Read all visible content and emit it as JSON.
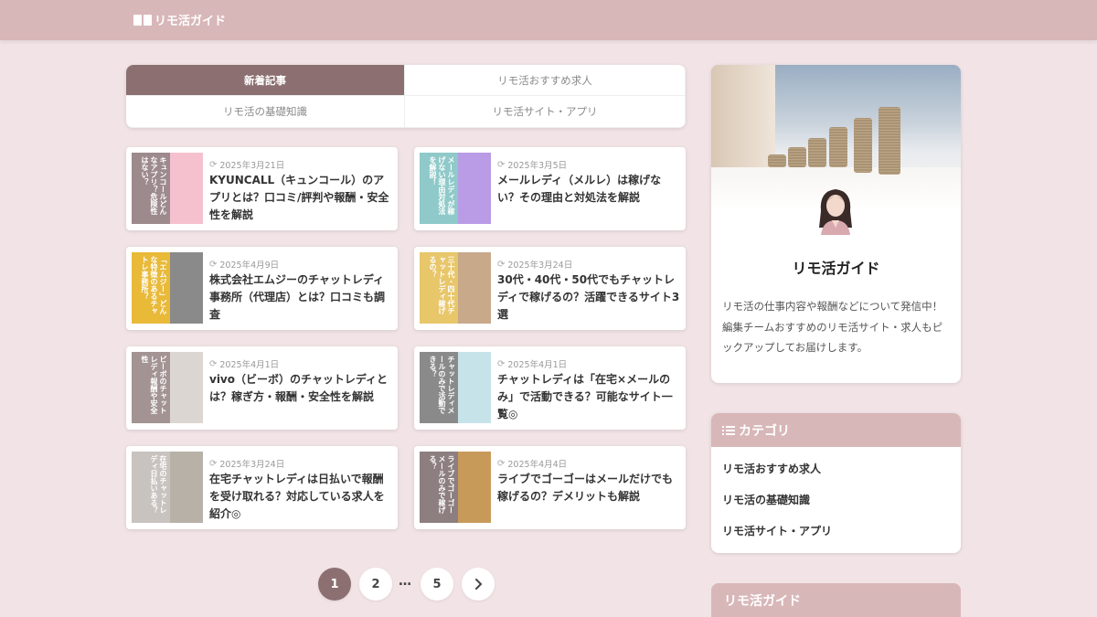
{
  "header": {
    "logo_text": "リモ活ガイド"
  },
  "tabs": [
    {
      "label": "新着記事",
      "active": true
    },
    {
      "label": "リモ活おすすめ求人",
      "active": false
    },
    {
      "label": "リモ活の基礎知識",
      "active": false
    },
    {
      "label": "リモ活サイト・アプリ",
      "active": false
    }
  ],
  "articles": [
    {
      "date": "2025年3月21日",
      "title": "KYUNCALL（キュンコール）のアプリとは？口コミ/評判や報酬・安全性を解説",
      "thumb_text": "キュンコールどんなアプリ？危険性はない？",
      "band_color": "#9d8a8d",
      "rest_color": "#f6c1cf"
    },
    {
      "date": "2025年3月5日",
      "title": "メールレディ（メルレ）は稼げない？その理由と対処法を解説",
      "thumb_text": "メールレディが稼げない理由対処法を解説！",
      "band_color": "#8fc9c9",
      "rest_color": "#b99be6"
    },
    {
      "date": "2025年4月9日",
      "title": "株式会社エムジーのチャットレディ事務所（代理店）とは？口コミも調査",
      "thumb_text": "「エムジー」どんな特徴のあるチャトレ事務所？",
      "band_color": "#e9b938",
      "rest_color": "#8a8a8a"
    },
    {
      "date": "2025年3月24日",
      "title": "30代・40代・50代でもチャットレディで稼げるの？活躍できるサイト3選",
      "thumb_text": "三十代・四十代チャットレディ稼げるの？",
      "band_color": "#e8c66a",
      "rest_color": "#c8a98a"
    },
    {
      "date": "2025年4月1日",
      "title": "vivo（ビーボ）のチャットレディとは？稼ぎ方・報酬・安全性を解説",
      "thumb_text": "ビーボのチャットレディ報酬や安全性",
      "band_color": "#a39393",
      "rest_color": "#dcd6d2"
    },
    {
      "date": "2025年4月1日",
      "title": "チャットレディは「在宅×メールのみ」で活動できる？可能なサイト一覧◎",
      "thumb_text": "チャットレディメールのみで活動できる？",
      "band_color": "#8a8a8a",
      "rest_color": "#c7e3ea"
    },
    {
      "date": "2025年3月24日",
      "title": "在宅チャットレディは日払いで報酬を受け取れる？対応している求人を紹介◎",
      "thumb_text": "在宅のチャットレディ日払いある？",
      "band_color": "#c9c3c0",
      "rest_color": "#b7b1a7"
    },
    {
      "date": "2025年4月4日",
      "title": "ライブでゴーゴーはメールだけでも稼げるの？デメリットも解説",
      "thumb_text": "ライブでゴーゴーメールのみで稼げる？",
      "band_color": "#8d7e7f",
      "rest_color": "#c79a5a"
    }
  ],
  "pagination": {
    "pages": [
      "1",
      "2",
      "5"
    ],
    "current": "1",
    "ellipsis": "…",
    "next_icon": "chevron-right-icon"
  },
  "profile": {
    "name": "リモ活ガイド",
    "description": "リモ活の仕事内容や報酬などについて発信中！編集チームおすすめのリモ活サイト・求人もピックアップしてお届けします。"
  },
  "category": {
    "heading": "カテゴリ",
    "items": [
      "リモ活おすすめ求人",
      "リモ活の基礎知識",
      "リモ活サイト・アプリ"
    ]
  },
  "sidebar_widget2": {
    "heading": "リモ活ガイド"
  },
  "colors": {
    "header": "#d8b7b9",
    "accent": "#8c7071",
    "background": "#f2e4e6"
  }
}
